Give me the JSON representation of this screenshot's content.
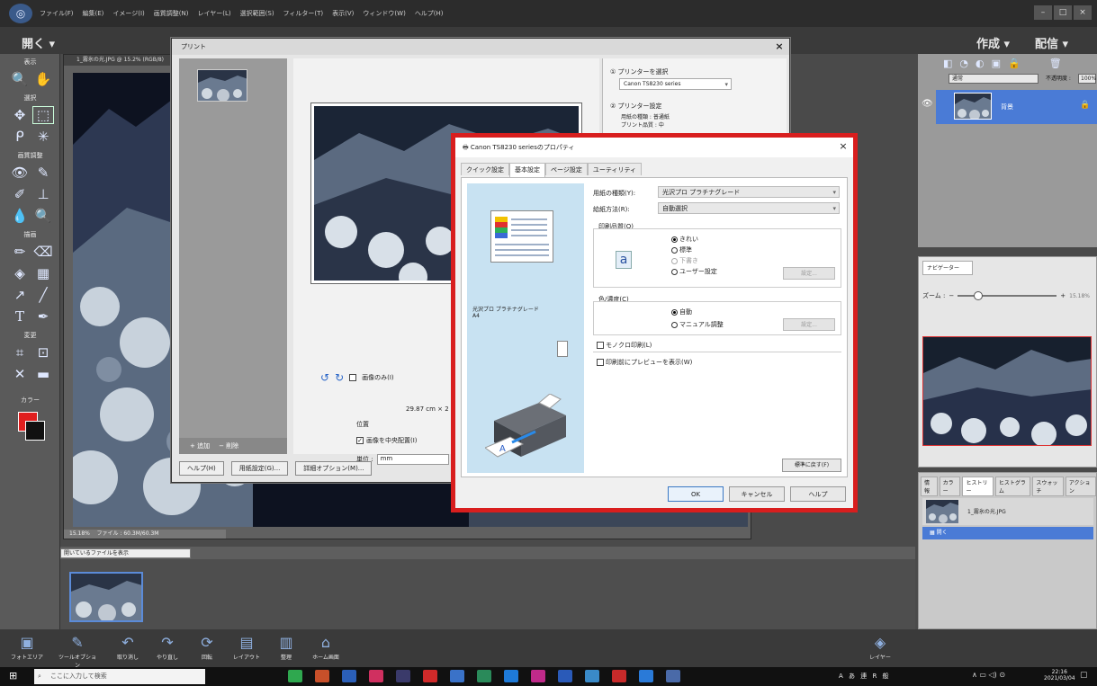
{
  "menubar": {
    "items": [
      "ファイル(F)",
      "編集(E)",
      "イメージ(I)",
      "画質調整(N)",
      "レイヤー(L)",
      "選択範囲(S)",
      "フィルター(T)",
      "表示(V)",
      "ウィンドウ(W)",
      "ヘルプ(H)"
    ],
    "window_buttons": [
      "–",
      "□",
      "×"
    ]
  },
  "modebar": {
    "open_label": "開く ▾",
    "create_label": "作成 ▾",
    "share_label": "配信 ▾"
  },
  "tools": {
    "labels": {
      "view": "表示",
      "select": "選択",
      "enhance": "画質調整",
      "draw": "描画",
      "modify": "変更",
      "color": "カラー"
    }
  },
  "document": {
    "title": "1_霧氷の光.JPG @ 15.2% (RGB/8)",
    "status_zoom": "15.18%",
    "status_file": "ファイル : 60.3M/60.3M"
  },
  "print_dialog": {
    "title": "プリント",
    "close": "×",
    "fit_on_page_label": "画像のみ(I)",
    "size_text": "29.87 cm × 2",
    "position_label": "位置",
    "center_image_label": "画像を中央配置(I)",
    "unit_label": "単位 :",
    "unit_value": "mm",
    "add_label": "+ 追加",
    "remove_label": "− 削除",
    "help_button": "ヘルプ(H)",
    "page_setup_button": "用紙設定(G)...",
    "more_options_button": "詳細オプション(M)...",
    "select_printer_label": "プリンターを選択",
    "printer_name": "Canon TS8230 series",
    "printer_settings_label": "プリンター設定",
    "paper_kind_line": "用紙の種類 : 普通紙",
    "quality_line": "プリント品質 : 中"
  },
  "properties_dialog": {
    "title": "Canon TS8230 seriesのプロパティ",
    "close": "×",
    "tabs": [
      "クイック設定",
      "基本設定",
      "ページ設定",
      "ユーティリティ"
    ],
    "paper_name": "光沢プロ プラチナグレード",
    "paper_size": "A4",
    "paper_type_label": "用紙の種類(Y):",
    "paper_type_value": "光沢プロ プラチナグレード",
    "feed_label": "給紙方法(R):",
    "feed_value": "自動選択",
    "quality_label": "印刷品質(Q)",
    "quality_icon_letter": "a",
    "quality_options": [
      "きれい",
      "標準",
      "下書き",
      "ユーザー設定"
    ],
    "settings_button": "設定...",
    "color_label": "色/濃度(C)",
    "color_options": [
      "自動",
      "マニュアル調整"
    ],
    "mono_label": "モノクロ印刷(L)",
    "preview_label": "印刷前にプレビューを表示(W)",
    "restore_button": "標準に戻す(F)",
    "ok": "OK",
    "cancel": "キャンセル",
    "help": "ヘルプ"
  },
  "layers_panel": {
    "blend": "通常",
    "opacity_label": "不透明度 :",
    "opacity_value": "100%",
    "layer_name": "背景"
  },
  "navigator": {
    "tab": "ナビゲーター",
    "zoom_label": "ズーム :",
    "zoom_minus": "−",
    "zoom_plus": "+",
    "zoom_value": "15.18%"
  },
  "history": {
    "tabs": [
      "情報",
      "カラー",
      "ヒストリー",
      "ヒストグラム",
      "スウォッチ",
      "アクション"
    ],
    "item1": "1_霧氷の光.JPG",
    "item2": "開く"
  },
  "photobin": {
    "show_label": "開いているファイルを表示"
  },
  "bottombar": {
    "items": [
      "フォトエリア",
      "ツールオプション",
      "取り消し",
      "やり直し",
      "回転",
      "レイアウト",
      "整理",
      "ホーム画面"
    ],
    "right_items": [
      "レイヤー"
    ]
  },
  "taskbar": {
    "search_placeholder": "ここに入力して検索",
    "ime": "A あ 連 R 般",
    "time": "22:16",
    "date": "2021/03/04"
  }
}
